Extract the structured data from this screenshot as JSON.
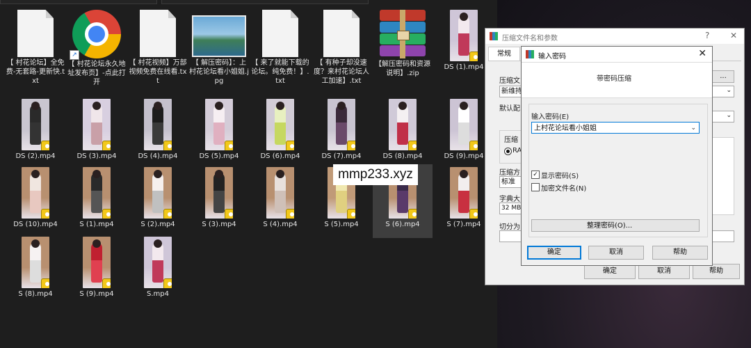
{
  "files": [
    {
      "type": "txt",
      "label": "【 村花论坛】全免费-无套路-更新快.txt"
    },
    {
      "type": "chrome",
      "label": "【 村花论坛永久地址发布页】-点此打开"
    },
    {
      "type": "txt",
      "label": "【 村花视频】万部视频免费在线看.txt"
    },
    {
      "type": "jpg",
      "label": "【 解压密码】：上村花论坛看小姐姐.jpg"
    },
    {
      "type": "txt",
      "label": "【 来了就能下载的论坛。纯免费！】.txt"
    },
    {
      "type": "txt",
      "label": "【 有种子却没速度？来村花论坛人工加速】.txt"
    },
    {
      "type": "zip",
      "label": "【解压密码和资源说明】.zip"
    },
    {
      "type": "video",
      "label": "DS (1).mp4"
    },
    {
      "type": "video",
      "label": "DS (2).mp4"
    },
    {
      "type": "video",
      "label": "DS (3).mp4"
    },
    {
      "type": "video",
      "label": "DS (4).mp4"
    },
    {
      "type": "video",
      "label": "DS (5).mp4"
    },
    {
      "type": "video",
      "label": "DS (6).mp4"
    },
    {
      "type": "video",
      "label": "DS (7).mp4"
    },
    {
      "type": "video",
      "label": "DS (8).mp4"
    },
    {
      "type": "video",
      "label": "DS (9).mp4"
    },
    {
      "type": "video",
      "label": "DS (10).mp4"
    },
    {
      "type": "video",
      "label": "S (1).mp4"
    },
    {
      "type": "video",
      "label": "S (2).mp4"
    },
    {
      "type": "video",
      "label": "S (3).mp4"
    },
    {
      "type": "video",
      "label": "S (4).mp4"
    },
    {
      "type": "video",
      "label": "S (5).mp4"
    },
    {
      "type": "video",
      "label": "S (6).mp4",
      "selected": true
    },
    {
      "type": "video",
      "label": "S (7).mp4"
    },
    {
      "type": "video",
      "label": "S (8).mp4"
    },
    {
      "type": "video",
      "label": "S (9).mp4"
    },
    {
      "type": "video",
      "label": "S.mp4"
    }
  ],
  "watermark": "mmp233.xyz",
  "archive_dialog": {
    "title": "压缩文件名和参数",
    "tab_general": "常规",
    "label_archive_name": "压缩文",
    "archive_name_value": "新维持",
    "label_default": "默认配",
    "label_format": "压缩",
    "format_option": "RA",
    "label_method": "压缩方",
    "method_value": "标准",
    "label_dict": "字典大",
    "dict_value": "32 MB",
    "label_split": "切分为",
    "ok": "确定",
    "cancel": "取消",
    "help": "帮助",
    "help_symbol": "?",
    "close_symbol": "✕"
  },
  "password_dialog": {
    "title": "输入密码",
    "heading": "带密码压缩",
    "label_password": "输入密码(E)",
    "password_value": "上村花论坛看小姐姐",
    "show_password": "显示密码(S)",
    "show_password_checked": true,
    "encrypt_filenames": "加密文件名(N)",
    "encrypt_filenames_checked": false,
    "organize": "整理密码(O)...",
    "ok": "确定",
    "cancel": "取消",
    "help": "帮助",
    "close_symbol": "✕"
  },
  "colors": {
    "accent": "#0078d7",
    "badge": "#f2c81a"
  }
}
